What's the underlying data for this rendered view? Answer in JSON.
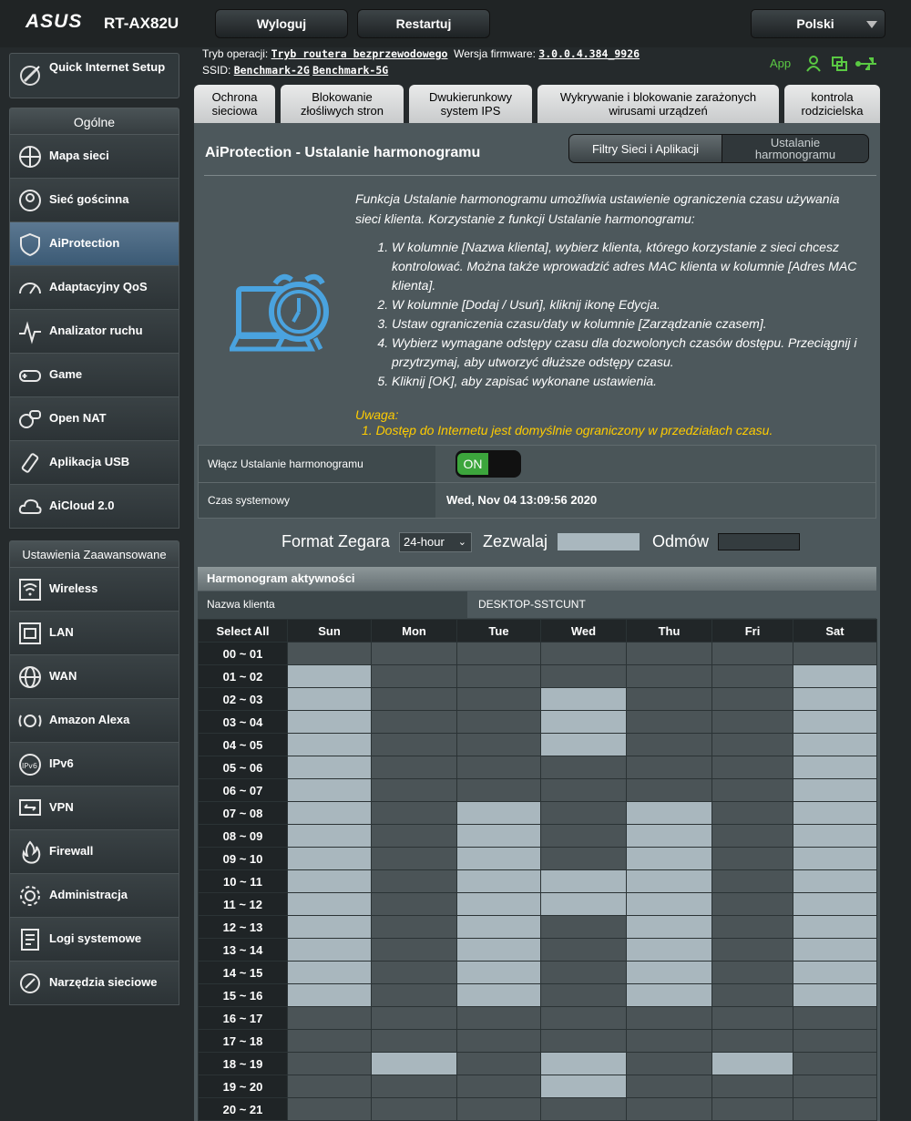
{
  "header": {
    "logo": "ASUS",
    "model": "RT-AX82U",
    "logout_label": "Wyloguj",
    "restart_label": "Restartuj",
    "language": "Polski",
    "mode_label": "Tryb operacji:",
    "mode_value": "Tryb routera bezprzewodowego",
    "firmware_label": "Wersja firmware:",
    "firmware_value": "3.0.0.4.384_9926",
    "ssid_label": "SSID:",
    "ssid_2g": "Benchmark-2G",
    "ssid_5g": "Benchmark-5G",
    "app_label": "App"
  },
  "sidebar": {
    "qis_label": "Quick Internet Setup",
    "general_header": "Ogólne",
    "general_items": [
      {
        "label": "Mapa sieci",
        "icon": "network-map-icon"
      },
      {
        "label": "Sieć gościnna",
        "icon": "guest-network-icon"
      },
      {
        "label": "AiProtection",
        "icon": "shield-icon",
        "active": true
      },
      {
        "label": "Adaptacyjny QoS",
        "icon": "speedometer-icon"
      },
      {
        "label": "Analizator ruchu",
        "icon": "traffic-analyzer-icon"
      },
      {
        "label": "Game",
        "icon": "gamepad-icon"
      },
      {
        "label": "Open NAT",
        "icon": "open-nat-icon"
      },
      {
        "label": "Aplikacja USB",
        "icon": "usb-icon"
      },
      {
        "label": "AiCloud 2.0",
        "icon": "cloud-icon"
      }
    ],
    "advanced_header": "Ustawienia Zaawansowane",
    "advanced_items": [
      {
        "label": "Wireless",
        "icon": "wifi-icon"
      },
      {
        "label": "LAN",
        "icon": "lan-icon"
      },
      {
        "label": "WAN",
        "icon": "globe-icon"
      },
      {
        "label": "Amazon Alexa",
        "icon": "alexa-icon"
      },
      {
        "label": "IPv6",
        "icon": "ipv6-icon"
      },
      {
        "label": "VPN",
        "icon": "vpn-icon"
      },
      {
        "label": "Firewall",
        "icon": "firewall-icon"
      },
      {
        "label": "Administracja",
        "icon": "gear-icon"
      },
      {
        "label": "Logi systemowe",
        "icon": "log-icon"
      },
      {
        "label": "Narzędzia sieciowe",
        "icon": "tools-icon"
      }
    ]
  },
  "tabs": [
    {
      "label": "Ochrona sieciowa"
    },
    {
      "label": "Blokowanie złośliwych stron"
    },
    {
      "label": "Dwukierunkowy system IPS"
    },
    {
      "label": "Wykrywanie i blokowanie zarażonych wirusami urządzeń"
    },
    {
      "label": "kontrola rodzicielska"
    }
  ],
  "main": {
    "title": "AiProtection - Ustalanie harmonogramu",
    "toggle_filters": "Filtry Sieci i Aplikacji",
    "toggle_schedule": "Ustalanie harmonogramu",
    "intro": "Funkcja Ustalanie harmonogramu umożliwia ustawienie ograniczenia czasu używania sieci klienta. Korzystanie z funkcji Ustalanie harmonogramu:",
    "steps": [
      "W kolumnie [Nazwa klienta], wybierz klienta, którego korzystanie z sieci chcesz kontrolować. Można także wprowadzić adres MAC klienta w kolumnie [Adres MAC klienta].",
      "W kolumnie [Dodaj / Usuń], kliknij ikonę Edycja.",
      "Ustaw ograniczenia czasu/daty w kolumnie [Zarządzanie czasem].",
      "Wybierz wymagane odstępy czasu dla dozwolonych czasów dostępu. Przeciągnij i przytrzymaj, aby utworzyć dłuższe odstępy czasu.",
      "Kliknij [OK], aby zapisać wykonane ustawienia."
    ],
    "note_title": "Uwaga:",
    "note_item": "1. Dostęp do Internetu jest domyślnie ograniczony w przedziałach czasu.",
    "enable_label": "Włącz Ustalanie harmonogramu",
    "enable_state": "ON",
    "systime_label": "Czas systemowy",
    "systime_value": "Wed, Nov 04 13:09:56 2020",
    "clock_format_label": "Format Zegara",
    "clock_format_value": "24-hour",
    "allow_label": "Zezwalaj",
    "deny_label": "Odmów"
  },
  "schedule": {
    "header": "Harmonogram aktywności",
    "client_label": "Nazwa klienta",
    "client_value": "DESKTOP-SSTCUNT",
    "select_all": "Select All",
    "days": [
      "Sun",
      "Mon",
      "Tue",
      "Wed",
      "Thu",
      "Fri",
      "Sat"
    ],
    "rows": [
      {
        "time": "00 ~ 01",
        "allowed": [
          0,
          0,
          0,
          0,
          0,
          0,
          0
        ]
      },
      {
        "time": "01 ~ 02",
        "allowed": [
          1,
          0,
          0,
          0,
          0,
          0,
          1
        ]
      },
      {
        "time": "02 ~ 03",
        "allowed": [
          1,
          0,
          0,
          1,
          0,
          0,
          1
        ]
      },
      {
        "time": "03 ~ 04",
        "allowed": [
          1,
          0,
          0,
          1,
          0,
          0,
          1
        ]
      },
      {
        "time": "04 ~ 05",
        "allowed": [
          1,
          0,
          0,
          1,
          0,
          0,
          1
        ]
      },
      {
        "time": "05 ~ 06",
        "allowed": [
          1,
          0,
          0,
          0,
          0,
          0,
          1
        ]
      },
      {
        "time": "06 ~ 07",
        "allowed": [
          1,
          0,
          0,
          0,
          0,
          0,
          1
        ]
      },
      {
        "time": "07 ~ 08",
        "allowed": [
          1,
          0,
          1,
          0,
          1,
          0,
          1
        ]
      },
      {
        "time": "08 ~ 09",
        "allowed": [
          1,
          0,
          1,
          0,
          1,
          0,
          1
        ]
      },
      {
        "time": "09 ~ 10",
        "allowed": [
          1,
          0,
          1,
          0,
          1,
          0,
          1
        ]
      },
      {
        "time": "10 ~ 11",
        "allowed": [
          1,
          0,
          1,
          1,
          1,
          0,
          1
        ]
      },
      {
        "time": "11 ~ 12",
        "allowed": [
          1,
          0,
          1,
          1,
          1,
          0,
          1
        ]
      },
      {
        "time": "12 ~ 13",
        "allowed": [
          1,
          0,
          1,
          0,
          1,
          0,
          1
        ]
      },
      {
        "time": "13 ~ 14",
        "allowed": [
          1,
          0,
          1,
          0,
          1,
          0,
          1
        ]
      },
      {
        "time": "14 ~ 15",
        "allowed": [
          1,
          0,
          1,
          0,
          1,
          0,
          1
        ]
      },
      {
        "time": "15 ~ 16",
        "allowed": [
          1,
          0,
          1,
          0,
          1,
          0,
          1
        ]
      },
      {
        "time": "16 ~ 17",
        "allowed": [
          0,
          0,
          0,
          0,
          0,
          0,
          0
        ]
      },
      {
        "time": "17 ~ 18",
        "allowed": [
          0,
          0,
          0,
          0,
          0,
          0,
          0
        ]
      },
      {
        "time": "18 ~ 19",
        "allowed": [
          0,
          1,
          0,
          1,
          0,
          1,
          0
        ]
      },
      {
        "time": "19 ~ 20",
        "allowed": [
          0,
          0,
          0,
          1,
          0,
          0,
          0
        ]
      },
      {
        "time": "20 ~ 21",
        "allowed": [
          0,
          0,
          0,
          0,
          0,
          0,
          0
        ]
      }
    ]
  },
  "colors": {
    "allowed": "#a9b7be",
    "denied": "#4b5457",
    "accent_green": "#5ac943",
    "note_yellow": "#ffcc00"
  }
}
